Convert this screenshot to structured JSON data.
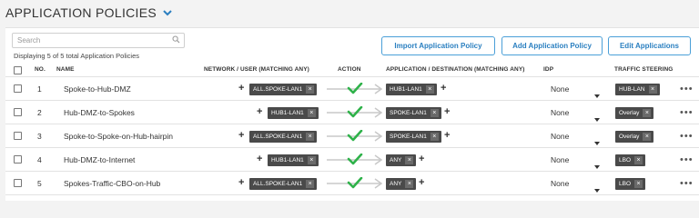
{
  "header": {
    "title": "APPLICATION POLICIES"
  },
  "toolbar": {
    "search_placeholder": "Search",
    "count_text": "Displaying 5 of 5 total Application Policies",
    "import_label": "Import Application Policy",
    "add_label": "Add Application Policy",
    "edit_label": "Edit Applications"
  },
  "columns": {
    "no": "NO.",
    "name": "NAME",
    "network": "NETWORK / USER (MATCHING ANY)",
    "action": "ACTION",
    "application": "APPLICATION / DESTINATION (MATCHING ANY)",
    "idp": "IDP",
    "traffic": "TRAFFIC STEERING"
  },
  "rows": [
    {
      "no": "1",
      "name": "Spoke-to-Hub-DMZ",
      "network": "ALL.SPOKE-LAN1",
      "application": "HUB1-LAN1",
      "idp": "None",
      "traffic": "HUB-LAN"
    },
    {
      "no": "2",
      "name": "Hub-DMZ-to-Spokes",
      "network": "HUB1-LAN1",
      "application": "SPOKE-LAN1",
      "idp": "None",
      "traffic": "Overlay"
    },
    {
      "no": "3",
      "name": "Spoke-to-Spoke-on-Hub-hairpin",
      "network": "ALL.SPOKE-LAN1",
      "application": "SPOKE-LAN1",
      "idp": "None",
      "traffic": "Overlay"
    },
    {
      "no": "4",
      "name": "Hub-DMZ-to-Internet",
      "network": "HUB1-LAN1",
      "application": "ANY",
      "idp": "None",
      "traffic": "LBO"
    },
    {
      "no": "5",
      "name": "Spokes-Traffic-CBO-on-Hub",
      "network": "ALL.SPOKE-LAN1",
      "application": "ANY",
      "idp": "None",
      "traffic": "LBO"
    }
  ],
  "glyphs": {
    "close": "×",
    "add": "+",
    "more": "•••"
  },
  "colors": {
    "accent": "#2a7fc0",
    "tag_bg": "#4a4a4a",
    "check": "#2fb24a"
  }
}
